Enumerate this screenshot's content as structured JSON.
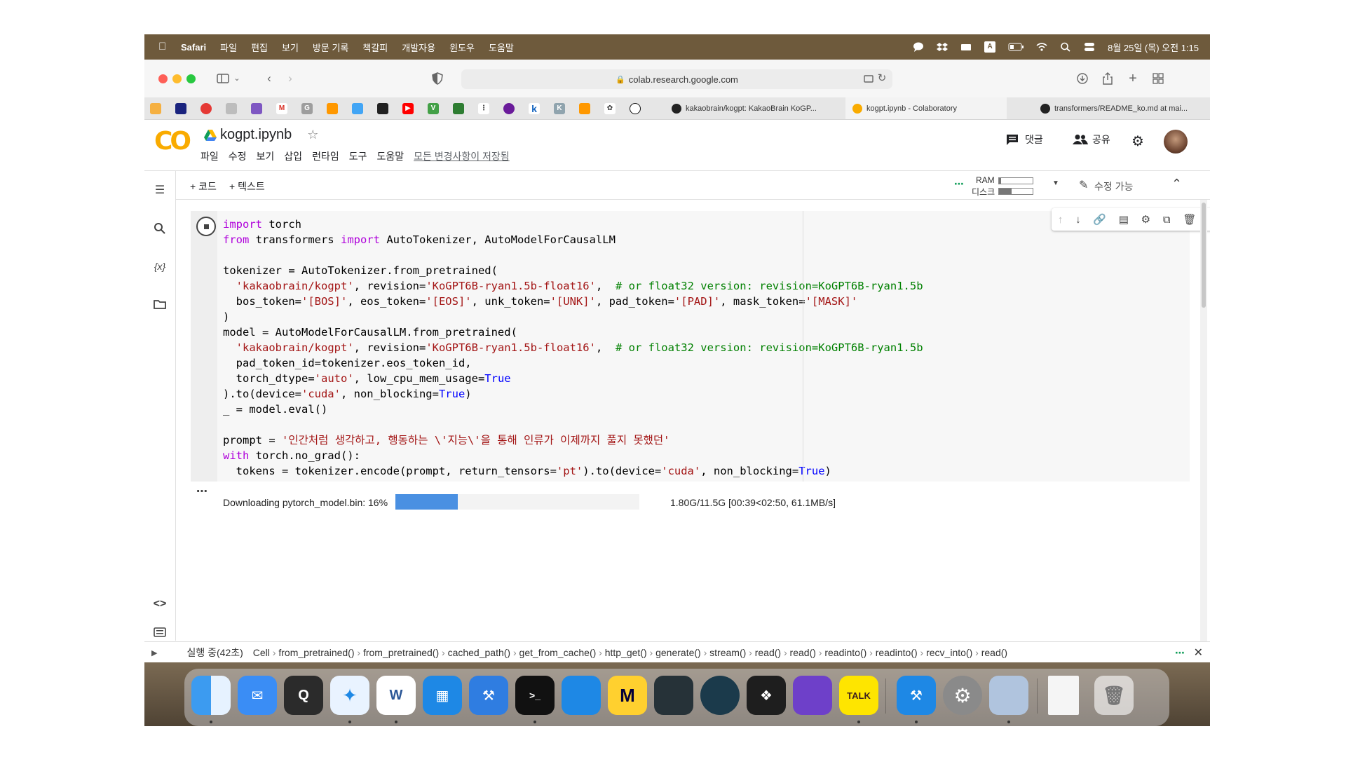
{
  "menubar": {
    "app_name": "Safari",
    "items": [
      "파일",
      "편집",
      "보기",
      "방문 기록",
      "책갈피",
      "개발자용",
      "윈도우",
      "도움말"
    ],
    "datetime": "8월 25일 (목) 오전 1:15"
  },
  "browser": {
    "address": "colab.research.google.com",
    "tabs": [
      {
        "title": "kakaobrain/kogpt: KakaoBrain KoGP..."
      },
      {
        "title": "kogpt.ipynb - Colaboratory"
      },
      {
        "title": "transformers/README_ko.md at mai..."
      }
    ]
  },
  "colab": {
    "logo": "CO",
    "notebook_title": "kogpt.ipynb",
    "menu": [
      "파일",
      "수정",
      "보기",
      "삽입",
      "런타임",
      "도구",
      "도움말"
    ],
    "saved_status": "모든 변경사항이 저장됨",
    "comment_label": "댓글",
    "share_label": "공유",
    "add_code_label": "+ 코드",
    "add_text_label": "+ 텍스트",
    "ram_label": "RAM",
    "disk_label": "디스크",
    "edit_mode_label": "수정 가능"
  },
  "output": {
    "progress_label": "Downloading pytorch_model.bin: 16%",
    "progress_fraction": 0.16,
    "progress_stats": "1.80G/11.5G [00:39<02:50, 61.1MB/s]"
  },
  "statusbar": {
    "running": "실행 중(42초)",
    "trace": [
      "Cell",
      "from_pretrained()",
      "from_pretrained()",
      "cached_path()",
      "get_from_cache()",
      "http_get()",
      "generate()",
      "stream()",
      "read()",
      "read()",
      "readinto()",
      "readinto()",
      "recv_into()",
      "read()"
    ]
  },
  "dock": {
    "apps": [
      "Finder",
      "Mail",
      "QuickTime",
      "Safari",
      "Word",
      "Keynote",
      "Xcode",
      "Terminal",
      "Sourcetree",
      "Miro",
      "Xcode Cleaner",
      "GitKraken",
      "Figma",
      "GitHub Desktop",
      "KakaoTalk",
      "App Store",
      "System Preferences",
      "Preview",
      "Text File",
      "Trash"
    ],
    "kakaotalk_label": "TALK",
    "word_label": "W"
  },
  "colors": {
    "menubar": "#6e5a3c",
    "colab_orange": "#f9ab00",
    "progress": "#4a90e2",
    "keyword": "#af00db",
    "builtin": "#0000ff",
    "string": "#a31515",
    "comment": "#008000",
    "number": "#098658"
  }
}
